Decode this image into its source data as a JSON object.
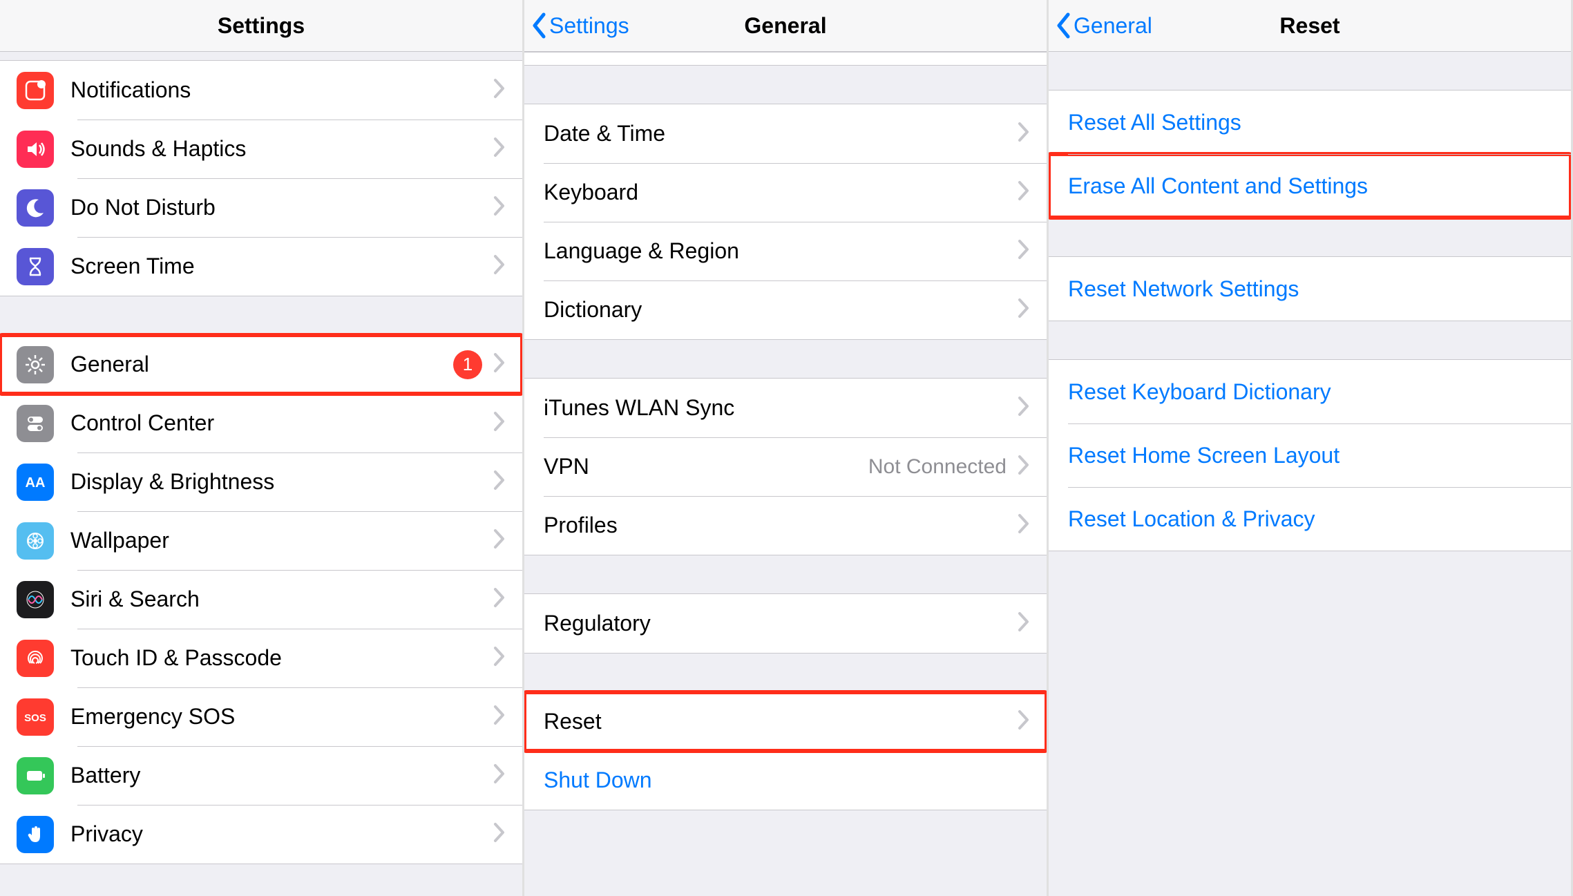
{
  "panel1": {
    "title": "Settings",
    "groups": [
      {
        "items": [
          {
            "key": "notifications",
            "label": "Notifications",
            "icon": "notifications-icon",
            "bg": "#ff3b30"
          },
          {
            "key": "sounds",
            "label": "Sounds & Haptics",
            "icon": "sounds-icon",
            "bg": "#ff2d55"
          },
          {
            "key": "dnd",
            "label": "Do Not Disturb",
            "icon": "moon-icon",
            "bg": "#5856d6"
          },
          {
            "key": "screentime",
            "label": "Screen Time",
            "icon": "hourglass-icon",
            "bg": "#5856d6"
          }
        ]
      },
      {
        "items": [
          {
            "key": "general",
            "label": "General",
            "icon": "gear-icon",
            "bg": "#8e8e93",
            "badge": "1",
            "highlight": true
          },
          {
            "key": "controlcenter",
            "label": "Control Center",
            "icon": "switches-icon",
            "bg": "#8e8e93"
          },
          {
            "key": "display",
            "label": "Display & Brightness",
            "icon": "text-size-icon",
            "bg": "#007aff"
          },
          {
            "key": "wallpaper",
            "label": "Wallpaper",
            "icon": "wallpaper-icon",
            "bg": "#55bef0"
          },
          {
            "key": "siri",
            "label": "Siri & Search",
            "icon": "siri-icon",
            "bg": "#1c1c1e"
          },
          {
            "key": "touchid",
            "label": "Touch ID & Passcode",
            "icon": "fingerprint-icon",
            "bg": "#ff3b30"
          },
          {
            "key": "sos",
            "label": "Emergency SOS",
            "icon": "sos-icon",
            "bg": "#ff3b30"
          },
          {
            "key": "battery",
            "label": "Battery",
            "icon": "battery-icon",
            "bg": "#34c759"
          },
          {
            "key": "privacy",
            "label": "Privacy",
            "icon": "hand-icon",
            "bg": "#007aff"
          }
        ]
      }
    ]
  },
  "panel2": {
    "back": "Settings",
    "title": "General",
    "groups": [
      {
        "items": [
          {
            "key": "datetime",
            "label": "Date & Time"
          },
          {
            "key": "keyboard",
            "label": "Keyboard"
          },
          {
            "key": "language",
            "label": "Language & Region"
          },
          {
            "key": "dictionary",
            "label": "Dictionary"
          }
        ]
      },
      {
        "items": [
          {
            "key": "itunessync",
            "label": "iTunes WLAN Sync"
          },
          {
            "key": "vpn",
            "label": "VPN",
            "detail": "Not Connected"
          },
          {
            "key": "profiles",
            "label": "Profiles"
          }
        ]
      },
      {
        "items": [
          {
            "key": "regulatory",
            "label": "Regulatory"
          }
        ]
      },
      {
        "items": [
          {
            "key": "reset",
            "label": "Reset",
            "highlight": true
          },
          {
            "key": "shutdown",
            "label": "Shut Down",
            "link": true,
            "nochevron": true
          }
        ]
      }
    ]
  },
  "panel3": {
    "back": "General",
    "title": "Reset",
    "groups": [
      {
        "items": [
          {
            "key": "resetall",
            "label": "Reset All Settings"
          },
          {
            "key": "eraseall",
            "label": "Erase All Content and Settings",
            "highlight": true
          }
        ]
      },
      {
        "items": [
          {
            "key": "resetnetwork",
            "label": "Reset Network Settings"
          }
        ]
      },
      {
        "items": [
          {
            "key": "resetkeyboard",
            "label": "Reset Keyboard Dictionary"
          },
          {
            "key": "resethome",
            "label": "Reset Home Screen Layout"
          },
          {
            "key": "resetlocation",
            "label": "Reset Location & Privacy"
          }
        ]
      }
    ]
  }
}
